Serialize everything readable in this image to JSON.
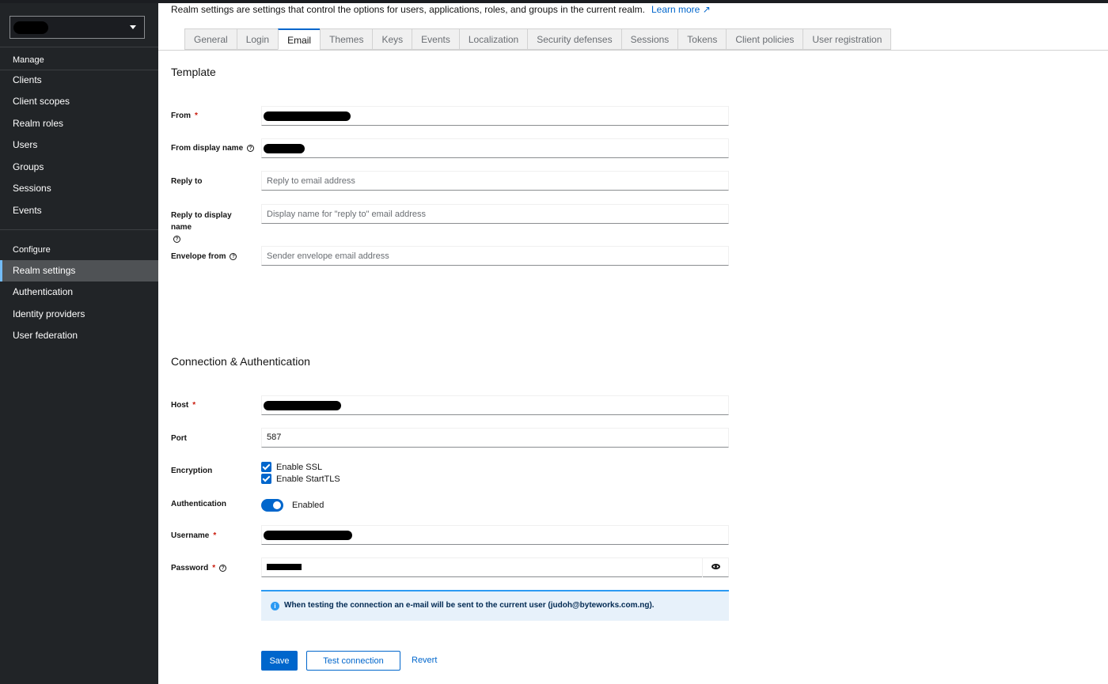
{
  "sidebar": {
    "realm_name": "",
    "manage_label": "Manage",
    "manage_items": [
      "Clients",
      "Client scopes",
      "Realm roles",
      "Users",
      "Groups",
      "Sessions",
      "Events"
    ],
    "configure_label": "Configure",
    "configure_items": [
      "Realm settings",
      "Authentication",
      "Identity providers",
      "User federation"
    ],
    "active_item": "Realm settings"
  },
  "header": {
    "description": "Realm settings are settings that control the options for users, applications, roles, and groups in the current realm.",
    "learn_more": "Learn more"
  },
  "tabs": [
    "General",
    "Login",
    "Email",
    "Themes",
    "Keys",
    "Events",
    "Localization",
    "Security defenses",
    "Sessions",
    "Tokens",
    "Client policies",
    "User registration"
  ],
  "active_tab": "Email",
  "template": {
    "title": "Template",
    "from_label": "From",
    "from_display_name_label": "From display name",
    "reply_to_label": "Reply to",
    "reply_to_placeholder": "Reply to email address",
    "reply_to_display_name_label": "Reply to display name",
    "reply_to_display_name_placeholder": "Display name for \"reply to\" email address",
    "envelope_from_label": "Envelope from",
    "envelope_from_placeholder": "Sender envelope email address"
  },
  "connection": {
    "title": "Connection & Authentication",
    "host_label": "Host",
    "port_label": "Port",
    "port_value": "587",
    "encryption_label": "Encryption",
    "enable_ssl": "Enable SSL",
    "enable_starttls": "Enable StartTLS",
    "authentication_label": "Authentication",
    "authentication_value": "Enabled",
    "username_label": "Username",
    "password_label": "Password",
    "alert_message": "When testing the connection an e-mail will be sent to the current user (judoh@byteworks.com.ng)."
  },
  "actions": {
    "save": "Save",
    "test_connection": "Test connection",
    "revert": "Revert"
  },
  "colors": {
    "primary": "#0066cc",
    "sidebar_bg": "#212427",
    "active_indicator": "#73bcf7",
    "required": "#c9190b",
    "info_bg": "#e7f1fa"
  }
}
